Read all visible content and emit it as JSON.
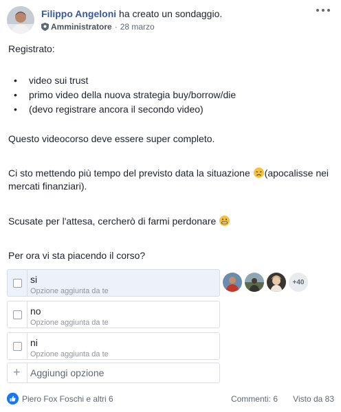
{
  "post": {
    "author": "Filippo Angeloni",
    "action": "ha creato un sondaggio.",
    "role": "Amministratore",
    "separator": "·",
    "date": "28 marzo",
    "more_icon": "more-dots-icon",
    "paragraphs": {
      "registered": "Registrato:",
      "bullets": [
        "video sui trust",
        "primo video della nuova strategia buy/borrow/die",
        "(devo registrare ancora il secondo video)"
      ],
      "complete": "Questo videocorso deve essere super completo.",
      "time_line1": "Ci sto mettendo più tempo del previsto data la situazione",
      "time_line1_tail": "(apocalisse nei",
      "time_line2": "mercati finanziari).",
      "sorry": "Scusate per l'attesa, cercherò di farmi perdonare",
      "question": "Per ora vi sta piacendo il corso?"
    }
  },
  "poll": {
    "options": [
      {
        "label": "si",
        "sub": "Opzione aggiunta da te"
      },
      {
        "label": "no",
        "sub": "Opzione aggiunta da te"
      },
      {
        "label": "ni",
        "sub": "Opzione aggiunta da te"
      }
    ],
    "add_option": "Aggiungi opzione",
    "more_voters": "+40"
  },
  "footer": {
    "likers": "Piero Fox Foschi e altri 6",
    "comments": "Commenti: 6",
    "views": "Visto da 83"
  },
  "colors": {
    "author": "#385898",
    "like": "#1877f2",
    "selected": "#edf2fa"
  }
}
